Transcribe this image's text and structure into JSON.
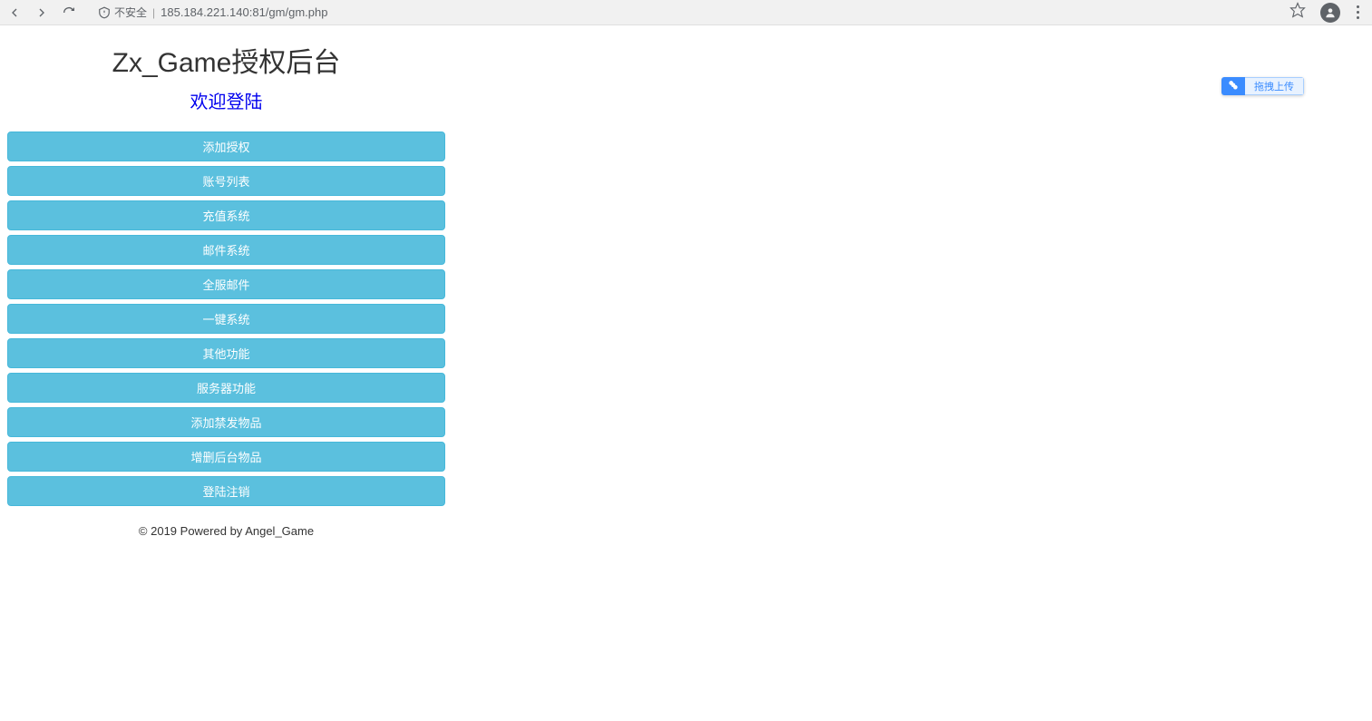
{
  "browser": {
    "security_label": "不安全",
    "url": "185.184.221.140:81/gm/gm.php"
  },
  "header": {
    "title": "Zx_Game授权后台",
    "welcome": "欢迎登陆"
  },
  "menu": {
    "items": [
      {
        "label": "添加授权"
      },
      {
        "label": "账号列表"
      },
      {
        "label": "充值系统"
      },
      {
        "label": "邮件系统"
      },
      {
        "label": "全服邮件"
      },
      {
        "label": "一键系统"
      },
      {
        "label": "其他功能"
      },
      {
        "label": "服务器功能"
      },
      {
        "label": "添加禁发物品"
      },
      {
        "label": "增删后台物品"
      },
      {
        "label": "登陆注销"
      }
    ]
  },
  "footer": {
    "copyright": "© 2019 Powered by Angel_Game"
  },
  "widget": {
    "upload_label": "拖拽上传"
  }
}
